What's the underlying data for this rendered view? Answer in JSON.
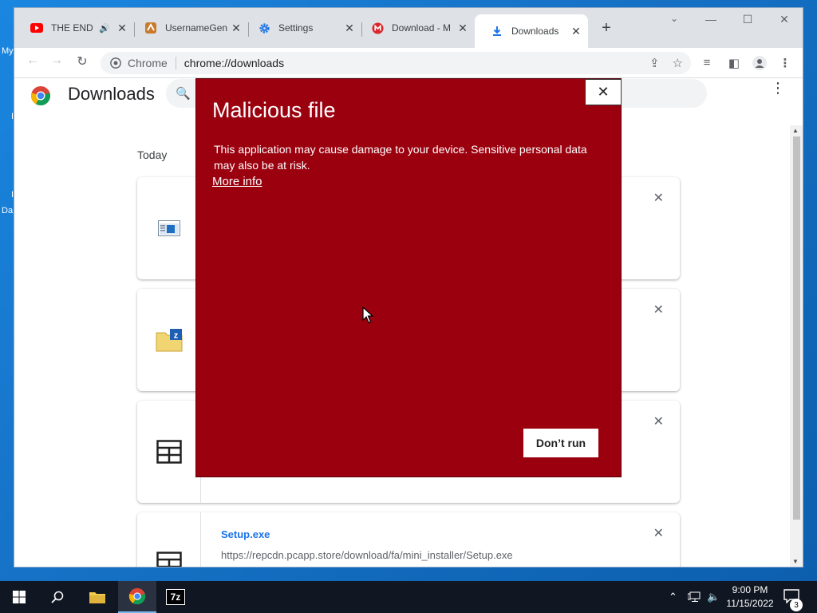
{
  "desktop": {
    "icon_labels": [
      "My",
      "I",
      "I",
      "Da"
    ]
  },
  "tabs": [
    {
      "title": "THE END c",
      "icon": "youtube-icon",
      "audio": true
    },
    {
      "title": "UsernameGen",
      "icon": "usernamegen-icon"
    },
    {
      "title": "Settings",
      "icon": "settings-gear-icon"
    },
    {
      "title": "Download - M",
      "icon": "mega-icon"
    },
    {
      "title": "Downloads",
      "icon": "download-arrow-icon",
      "active": true
    }
  ],
  "omnibox": {
    "chip": "Chrome",
    "url": "chrome://downloads"
  },
  "page": {
    "title": "Downloads",
    "section": "Today",
    "downloads": [
      {
        "icon": "window-file-icon",
        "name": "",
        "url": ""
      },
      {
        "icon": "zip-folder-icon",
        "name": "",
        "url": ""
      },
      {
        "icon": "exe-file-icon",
        "name": "",
        "url": ""
      },
      {
        "icon": "exe-file-icon",
        "name": "Setup.exe",
        "url": "https://repcdn.pcapp.store/download/fa/mini_installer/Setup.exe"
      }
    ]
  },
  "malicious_dialog": {
    "title": "Malicious file",
    "body": "This application may cause damage to your device. Sensitive personal data may also be at risk.",
    "link": "More info",
    "button": "Don’t run",
    "close": "✕",
    "background_color": "#9b000e"
  },
  "taskbar": {
    "apps": [
      "windows-start-icon",
      "search-icon",
      "file-explorer-icon",
      "chrome-icon",
      "7zip-icon"
    ],
    "app_7z_label": "7z",
    "time": "9:00 PM",
    "date": "11/15/2022",
    "notifications": "3"
  }
}
